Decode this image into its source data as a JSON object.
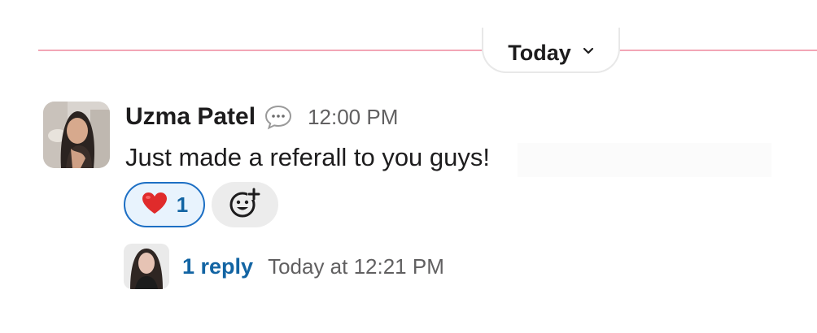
{
  "divider": {
    "date_label": "Today",
    "color": "#f2a6b6"
  },
  "message": {
    "author": "Uzma Patel",
    "status_icon": "speech-bubble-icon",
    "time": "12:00 PM",
    "text": "Just made a referall to you guys!",
    "reactions": [
      {
        "emoji": "heart",
        "count": "1"
      }
    ],
    "thread": {
      "reply_label": "1 reply",
      "last_reply": "Today at 12:21 PM"
    }
  },
  "colors": {
    "link": "#1264a3",
    "reaction_border": "#1d6fc4",
    "reaction_bg": "#e8f3fd"
  }
}
